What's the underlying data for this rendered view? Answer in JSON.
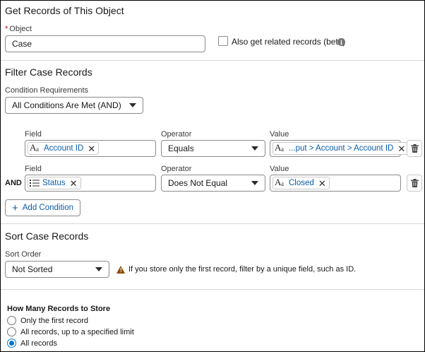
{
  "get_section": {
    "title": "Get Records of This Object",
    "object_label": "Object",
    "object_required": "*",
    "object_value": "Case",
    "related_label": "Also get related records (beta)"
  },
  "filter_section": {
    "title": "Filter Case Records",
    "requirements_label": "Condition Requirements",
    "requirements_value": "All Conditions Are Met (AND)",
    "conditions": [
      {
        "prefix": "",
        "field_label": "Field",
        "field_value": "Account ID",
        "field_icon": "text-type-icon",
        "operator_label": "Operator",
        "operator_value": "Equals",
        "value_label": "Value",
        "value_value": "...put > Account > Account ID",
        "value_icon": "text-type-icon"
      },
      {
        "prefix": "AND",
        "field_label": "Field",
        "field_value": "Status",
        "field_icon": "picklist-icon",
        "operator_label": "Operator",
        "operator_value": "Does Not Equal",
        "value_label": "Value",
        "value_value": "Closed",
        "value_icon": "text-type-icon"
      }
    ],
    "add_condition_label": "Add Condition"
  },
  "sort_section": {
    "title": "Sort Case Records",
    "order_label": "Sort Order",
    "order_value": "Not Sorted",
    "warning_text": "If you store only the first record, filter by a unique field, such as ID."
  },
  "store_section": {
    "title": "How Many Records to Store",
    "options": [
      {
        "label": "Only the first record",
        "checked": false
      },
      {
        "label": "All records, up to a specified limit",
        "checked": false
      },
      {
        "label": "All records",
        "checked": true
      }
    ]
  },
  "colors": {
    "link_blue": "#0b5cab",
    "radio_blue": "#0176d3",
    "warning_brown": "#8c4b02",
    "required_red": "#ba0517"
  }
}
